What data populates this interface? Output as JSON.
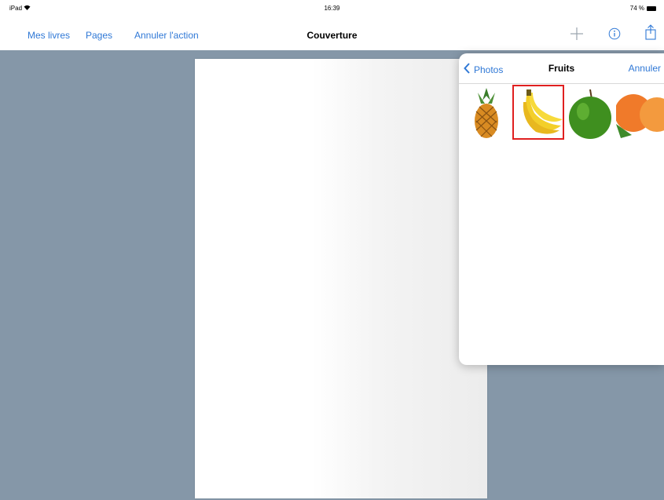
{
  "status_bar": {
    "device": "iPad",
    "time": "16:39",
    "battery": "74 %"
  },
  "nav": {
    "left_buttons": [
      "Mes livres",
      "Pages",
      "Annuler l'action"
    ],
    "title": "Couverture",
    "icons": [
      "add-icon",
      "info-icon",
      "share-icon"
    ]
  },
  "popover": {
    "back_label": "Photos",
    "title": "Fruits",
    "cancel_label": "Annuler",
    "thumbnails": [
      "pineapple",
      "banana",
      "green-apple",
      "oranges"
    ],
    "selected_index": 1
  },
  "colors": {
    "accent": "#2f78d6",
    "workspace": "#8597a8",
    "selection": "#e02020"
  }
}
